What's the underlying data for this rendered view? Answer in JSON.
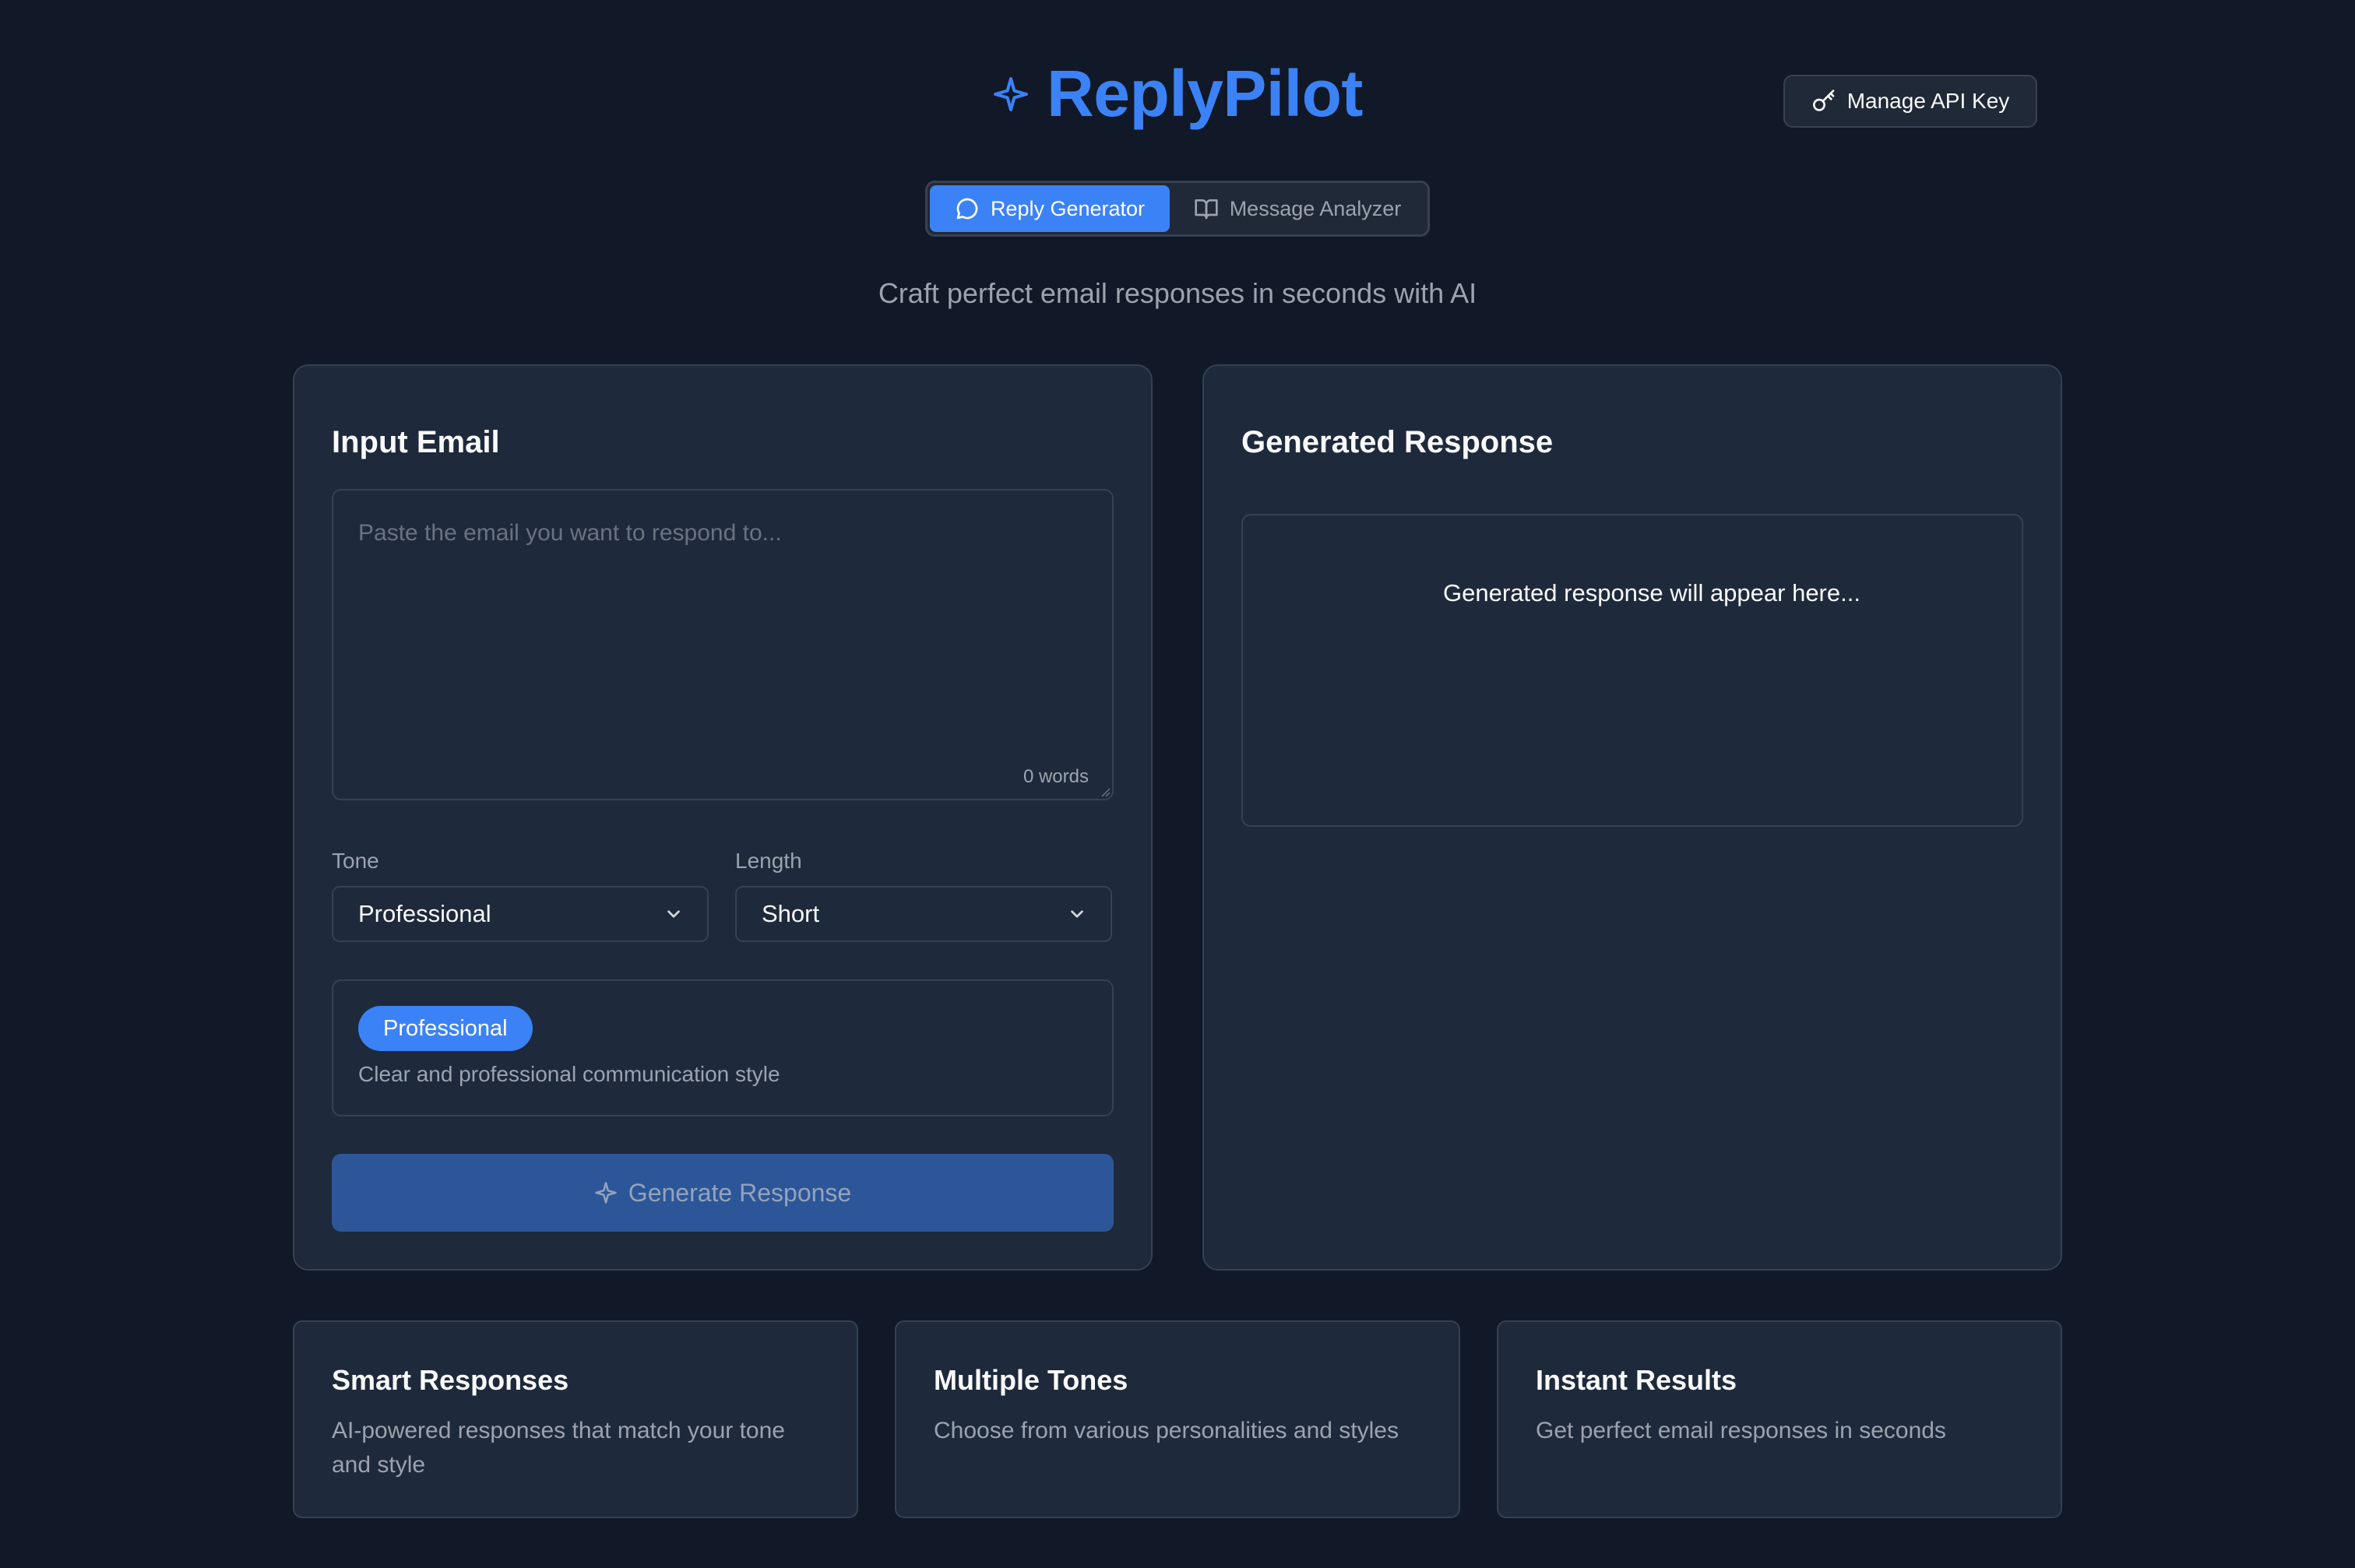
{
  "header": {
    "title": "ReplyPilot",
    "brand_icon": "sparkle-icon",
    "api_key_button": {
      "label": "Manage API Key",
      "icon": "key-icon"
    }
  },
  "tabs": [
    {
      "label": "Reply Generator",
      "icon": "message-circle-icon",
      "active": true
    },
    {
      "label": "Message Analyzer",
      "icon": "book-open-icon",
      "active": false
    }
  ],
  "tagline": "Craft perfect email responses in seconds with AI",
  "input_panel": {
    "title": "Input Email",
    "email_value": "",
    "email_placeholder": "Paste the email you want to respond to...",
    "word_count": "0 words",
    "tone": {
      "label": "Tone",
      "value": "Professional"
    },
    "length": {
      "label": "Length",
      "value": "Short"
    },
    "tone_preview": {
      "badge": "Professional",
      "description": "Clear and professional communication style"
    },
    "generate_button": "Generate Response"
  },
  "output_panel": {
    "title": "Generated Response",
    "placeholder": "Generated response will appear here..."
  },
  "features": [
    {
      "title": "Smart Responses",
      "description": "AI-powered responses that match your tone and style"
    },
    {
      "title": "Multiple Tones",
      "description": "Choose from various personalities and styles"
    },
    {
      "title": "Instant Results",
      "description": "Get perfect email responses in seconds"
    }
  ],
  "colors": {
    "background": "#111827",
    "panel": "#1e293b",
    "accent": "#3b82f6",
    "muted_text": "#9ca3af"
  }
}
